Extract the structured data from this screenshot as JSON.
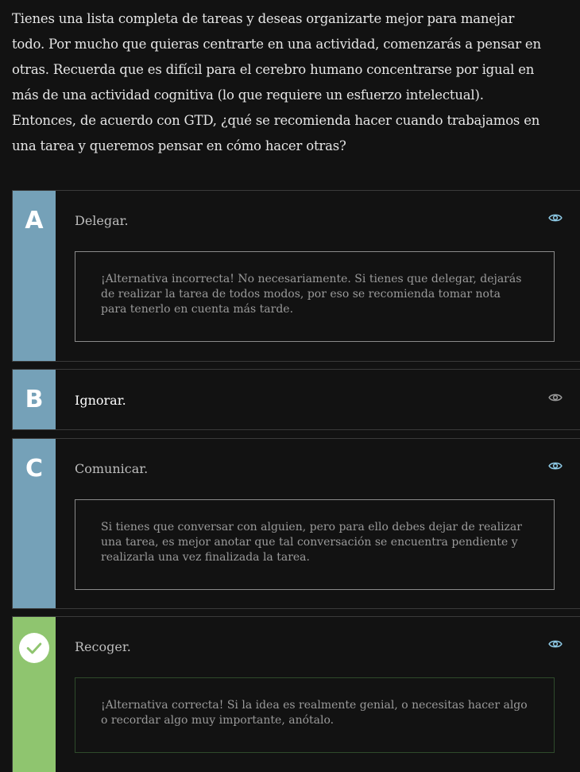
{
  "question": "Tienes una lista completa de tareas y deseas organizarte mejor para manejar todo. Por mucho que quieras centrarte en una actividad, comenzarás a pensar en otras. Recuerda que es difícil para el cerebro humano concentrarse por igual en más de una actividad cognitiva (lo que requiere un esfuerzo intelectual). Entonces, de acuerdo con GTD, ¿qué se recomienda hacer cuando trabajamos en una tarea y queremos pensar en cómo hacer otras?",
  "options": [
    {
      "letter": "A",
      "label": "Delegar.",
      "feedback": "¡Alternativa incorrecta! No necesariamente. Si tienes que delegar, dejarás de realizar la tarea de todos modos, por eso se recomienda tomar nota para tenerlo en cuenta más tarde."
    },
    {
      "letter": "B",
      "label": "Ignorar.",
      "feedback": ""
    },
    {
      "letter": "C",
      "label": "Comunicar.",
      "feedback": "Si tienes que conversar con alguien, pero para ello debes dejar de realizar una tarea, es mejor anotar que tal conversación se encuentra pendiente y realizarla una vez finalizada la tarea."
    },
    {
      "letter": "",
      "label": "Recoger.",
      "feedback": "¡Alternativa correcta! Si la idea es realmente genial, o necesitas hacer algo o recordar algo muy importante, anótalo.",
      "status": "correct"
    }
  ],
  "colors": {
    "letter_bg": "#75a1b8",
    "correct_bg": "#8fc56f",
    "background": "#121212",
    "eye_icon": "#8ecae6"
  }
}
